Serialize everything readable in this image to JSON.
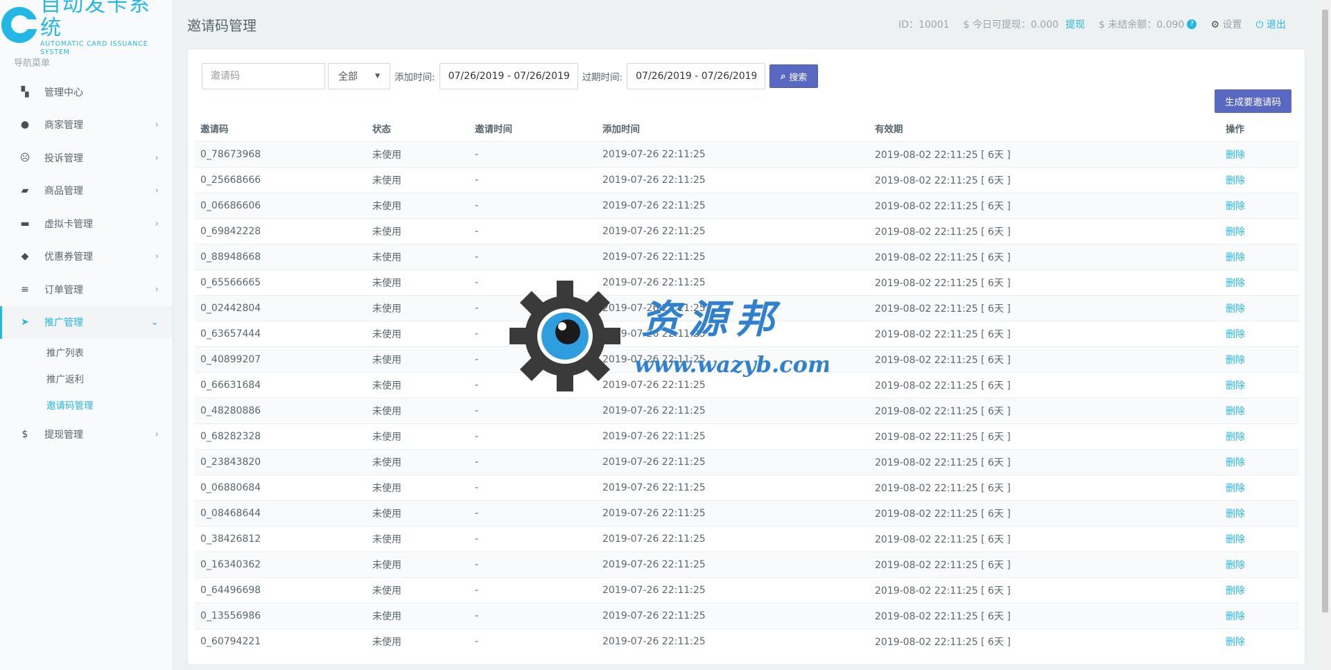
{
  "logo": {
    "title": "自动发卡系统",
    "subtitle": "AUTOMATIC CARD ISSUANCE SYSTEM"
  },
  "sidebar": {
    "header": "导航菜单",
    "items": [
      {
        "label": "管理中心",
        "icon": "dashboard-icon",
        "glyph": "▚",
        "arrow": ""
      },
      {
        "label": "商家管理",
        "icon": "user-icon",
        "glyph": "●",
        "arrow": "›"
      },
      {
        "label": "投诉管理",
        "icon": "frown-icon",
        "glyph": "☹",
        "arrow": "›"
      },
      {
        "label": "商品管理",
        "icon": "shopping-bag-icon",
        "glyph": "▰",
        "arrow": "›"
      },
      {
        "label": "虚拟卡管理",
        "icon": "credit-card-icon",
        "glyph": "▬",
        "arrow": "›"
      },
      {
        "label": "优惠券管理",
        "icon": "tag-icon",
        "glyph": "◆",
        "arrow": "›"
      },
      {
        "label": "订单管理",
        "icon": "list-icon",
        "glyph": "≡",
        "arrow": "›"
      },
      {
        "label": "推广管理",
        "icon": "paper-plane-icon",
        "glyph": "➤",
        "arrow": "⌄"
      }
    ],
    "subitems": [
      "推广列表",
      "推广返利",
      "邀请码管理"
    ],
    "last_item": {
      "label": "提现管理",
      "icon": "dollar-icon",
      "glyph": "$",
      "arrow": "›"
    }
  },
  "header": {
    "title": "邀请码管理",
    "id_label": "ID：",
    "id_value": "10001",
    "withdraw_label": "$ 今日可提现：",
    "withdraw_value": "0.000",
    "withdraw_link": "提现",
    "balance_label": "$ 未结余额：",
    "balance_value": "0.090",
    "qmark": "?",
    "settings": "设置",
    "logout": "退出"
  },
  "filter": {
    "code_placeholder": "邀请码",
    "status_value": "全部",
    "add_time_label": "添加时间:",
    "add_time_value": "07/26/2019 - 07/26/2019",
    "expire_time_label": "过期时间:",
    "expire_time_value": "07/26/2019 - 07/26/2019",
    "search_label": "搜索",
    "generate_label": "生成要邀请码"
  },
  "table": {
    "columns": [
      "邀请码",
      "状态",
      "邀请时间",
      "添加时间",
      "有效期",
      "操作"
    ],
    "rows": [
      [
        "0_78673968",
        "未使用",
        "-",
        "2019-07-26 22:11:25",
        "2019-08-02 22:11:25 [ 6天 ]",
        "删除"
      ],
      [
        "0_25668666",
        "未使用",
        "-",
        "2019-07-26 22:11:25",
        "2019-08-02 22:11:25 [ 6天 ]",
        "删除"
      ],
      [
        "0_06686606",
        "未使用",
        "-",
        "2019-07-26 22:11:25",
        "2019-08-02 22:11:25 [ 6天 ]",
        "删除"
      ],
      [
        "0_69842228",
        "未使用",
        "-",
        "2019-07-26 22:11:25",
        "2019-08-02 22:11:25 [ 6天 ]",
        "删除"
      ],
      [
        "0_88948668",
        "未使用",
        "-",
        "2019-07-26 22:11:25",
        "2019-08-02 22:11:25 [ 6天 ]",
        "删除"
      ],
      [
        "0_65566665",
        "未使用",
        "-",
        "2019-07-26 22:11:25",
        "2019-08-02 22:11:25 [ 6天 ]",
        "删除"
      ],
      [
        "0_02442804",
        "未使用",
        "-",
        "2019-07-26 22:11:25",
        "2019-08-02 22:11:25 [ 6天 ]",
        "删除"
      ],
      [
        "0_63657444",
        "未使用",
        "-",
        "2019-07-26 22:11:25",
        "2019-08-02 22:11:25 [ 6天 ]",
        "删除"
      ],
      [
        "0_40899207",
        "未使用",
        "-",
        "2019-07-26 22:11:25",
        "2019-08-02 22:11:25 [ 6天 ]",
        "删除"
      ],
      [
        "0_66631684",
        "未使用",
        "-",
        "2019-07-26 22:11:25",
        "2019-08-02 22:11:25 [ 6天 ]",
        "删除"
      ],
      [
        "0_48280886",
        "未使用",
        "-",
        "2019-07-26 22:11:25",
        "2019-08-02 22:11:25 [ 6天 ]",
        "删除"
      ],
      [
        "0_68282328",
        "未使用",
        "-",
        "2019-07-26 22:11:25",
        "2019-08-02 22:11:25 [ 6天 ]",
        "删除"
      ],
      [
        "0_23843820",
        "未使用",
        "-",
        "2019-07-26 22:11:25",
        "2019-08-02 22:11:25 [ 6天 ]",
        "删除"
      ],
      [
        "0_06880684",
        "未使用",
        "-",
        "2019-07-26 22:11:25",
        "2019-08-02 22:11:25 [ 6天 ]",
        "删除"
      ],
      [
        "0_08468644",
        "未使用",
        "-",
        "2019-07-26 22:11:25",
        "2019-08-02 22:11:25 [ 6天 ]",
        "删除"
      ],
      [
        "0_38426812",
        "未使用",
        "-",
        "2019-07-26 22:11:25",
        "2019-08-02 22:11:25 [ 6天 ]",
        "删除"
      ],
      [
        "0_16340362",
        "未使用",
        "-",
        "2019-07-26 22:11:25",
        "2019-08-02 22:11:25 [ 6天 ]",
        "删除"
      ],
      [
        "0_64496698",
        "未使用",
        "-",
        "2019-07-26 22:11:25",
        "2019-08-02 22:11:25 [ 6天 ]",
        "删除"
      ],
      [
        "0_13556986",
        "未使用",
        "-",
        "2019-07-26 22:11:25",
        "2019-08-02 22:11:25 [ 6天 ]",
        "删除"
      ],
      [
        "0_60794221",
        "未使用",
        "-",
        "2019-07-26 22:11:25",
        "2019-08-02 22:11:25 [ 6天 ]",
        "删除"
      ]
    ]
  },
  "watermark": {
    "title": "资源邦",
    "url": "www.wazyb.com"
  },
  "colors": {
    "accent": "#23b7e5",
    "button": "#5968c0",
    "text": "#58666e"
  }
}
